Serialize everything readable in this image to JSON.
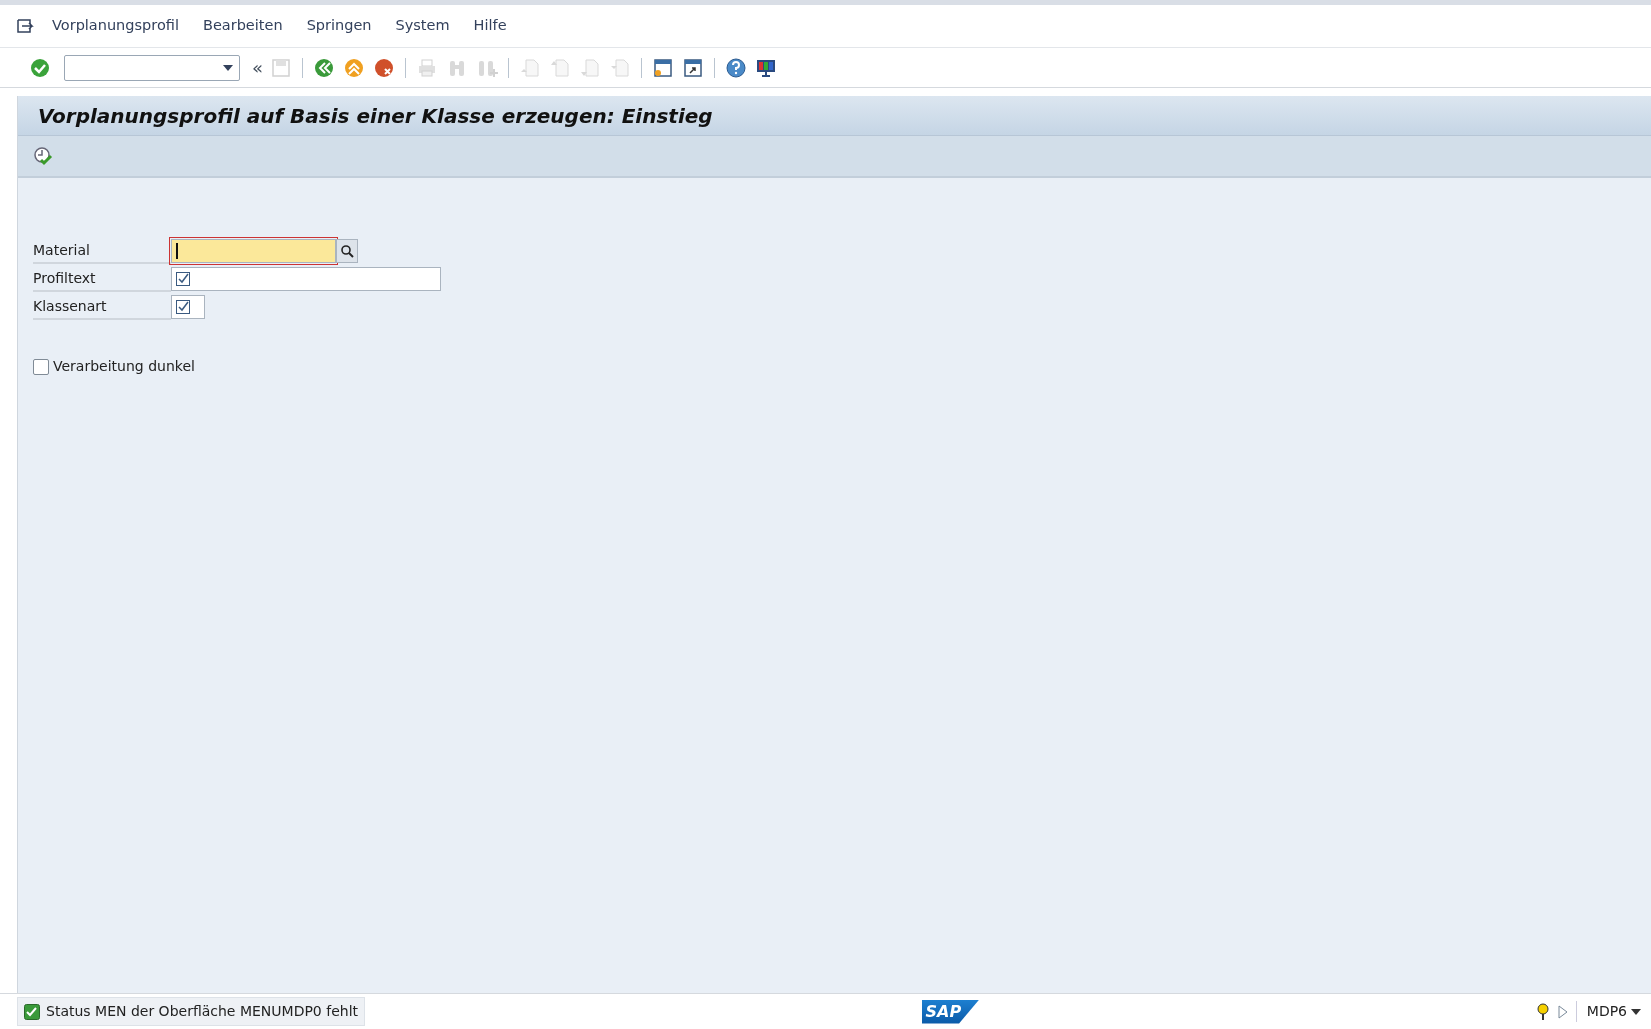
{
  "menu": [
    {
      "label": "Vorplanungsprofil"
    },
    {
      "label": "Bearbeiten"
    },
    {
      "label": "Springen"
    },
    {
      "label": "System"
    },
    {
      "label": "Hilfe"
    }
  ],
  "toolbar": [
    {
      "kind": "enter",
      "disabled": false
    },
    {
      "kind": "command"
    },
    {
      "kind": "collapse",
      "text": "«",
      "disabled": false
    },
    {
      "kind": "save",
      "disabled": true
    },
    {
      "kind": "sep"
    },
    {
      "kind": "back",
      "disabled": false
    },
    {
      "kind": "exit",
      "disabled": false
    },
    {
      "kind": "cancel",
      "disabled": false
    },
    {
      "kind": "sep"
    },
    {
      "kind": "print",
      "disabled": true
    },
    {
      "kind": "find",
      "disabled": true
    },
    {
      "kind": "findnext",
      "disabled": true
    },
    {
      "kind": "sep"
    },
    {
      "kind": "first",
      "disabled": true
    },
    {
      "kind": "prev",
      "disabled": true
    },
    {
      "kind": "next",
      "disabled": true
    },
    {
      "kind": "last",
      "disabled": true
    },
    {
      "kind": "sep"
    },
    {
      "kind": "newsession",
      "disabled": false
    },
    {
      "kind": "shortcut",
      "disabled": false
    },
    {
      "kind": "sep"
    },
    {
      "kind": "help",
      "disabled": false
    },
    {
      "kind": "layout",
      "disabled": false
    }
  ],
  "title": "Vorplanungsprofil auf Basis einer Klasse erzeugen: Einstieg",
  "fields": [
    {
      "label": "Material",
      "kind": "search",
      "focused": true
    },
    {
      "label": "Profiltext",
      "kind": "long",
      "focused": false
    },
    {
      "label": "Klassenart",
      "kind": "short",
      "focused": false
    }
  ],
  "option": {
    "label": "Verarbeitung dunkel",
    "checked": false
  },
  "status": {
    "message": "Status MEN der Oberfläche MENUMDP0 fehlt",
    "logo": "SAP",
    "system": "MDP6"
  }
}
